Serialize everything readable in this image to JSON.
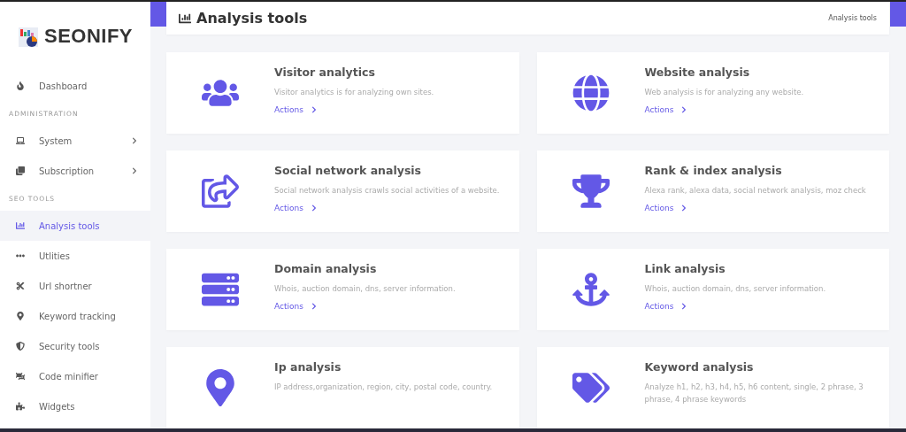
{
  "logo": {
    "text": "SEONIFY"
  },
  "sidebar": {
    "sections": [
      {
        "items": [
          {
            "label": "Dashboard",
            "selected": false,
            "has_submenu": false
          }
        ]
      },
      {
        "heading": "ADMINISTRATION",
        "items": [
          {
            "label": "System",
            "selected": false,
            "has_submenu": true
          },
          {
            "label": "Subscription",
            "selected": false,
            "has_submenu": true
          }
        ]
      },
      {
        "heading": "SEO TOOLS",
        "items": [
          {
            "label": "Analysis tools",
            "selected": true,
            "has_submenu": false
          },
          {
            "label": "Utlities",
            "selected": false,
            "has_submenu": false
          },
          {
            "label": "Url shortner",
            "selected": false,
            "has_submenu": false
          },
          {
            "label": "Keyword tracking",
            "selected": false,
            "has_submenu": false
          },
          {
            "label": "Security tools",
            "selected": false,
            "has_submenu": false
          },
          {
            "label": "Code minifier",
            "selected": false,
            "has_submenu": false
          },
          {
            "label": "Widgets",
            "selected": false,
            "has_submenu": false
          }
        ]
      }
    ]
  },
  "header": {
    "title": "Analysis tools",
    "breadcrumb": "Analysis tools"
  },
  "tools": [
    {
      "title": "Visitor analytics",
      "description": "Visitor analytics is for analyzing own sites.",
      "action": "Actions"
    },
    {
      "title": "Website analysis",
      "description": "Web analysis is for analyzing any website.",
      "action": "Actions"
    },
    {
      "title": "Social network analysis",
      "description": "Social network analysis crawls social activities of a website.",
      "action": "Actions"
    },
    {
      "title": "Rank & index analysis",
      "description": "Alexa rank, alexa data, social network analysis, moz check",
      "action": "Actions"
    },
    {
      "title": "Domain analysis",
      "description": "Whois, auction domain, dns, server information.",
      "action": "Actions"
    },
    {
      "title": "Link analysis",
      "description": "Whois, auction domain, dns, server information.",
      "action": "Actions"
    },
    {
      "title": "Ip analysis",
      "description": "IP address,organization, region, city, postal code, country."
    },
    {
      "title": "Keyword analysis",
      "description": "Analyze h1, h2, h3, h4, h5, h6 content, single, 2 phrase, 3 phrase, 4 phrase keywords"
    }
  ]
}
